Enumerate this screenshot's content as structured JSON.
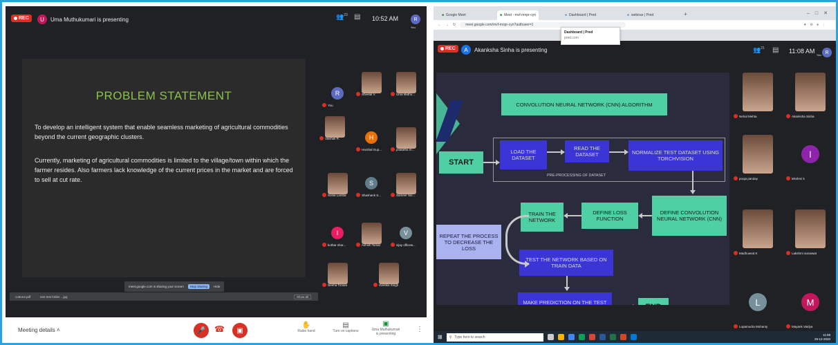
{
  "left": {
    "rec": "REC",
    "presenter_initial": "U",
    "presenter": "Uma Muthukumari is presenting",
    "time": "10:52 AM",
    "you_label": "You",
    "people_count": "23",
    "slide": {
      "title": "PROBLEM STATEMENT",
      "p1": "To develop an intelligent system that enable seamless marketing of agricultural commodities beyond the current geographic clusters.",
      "p2": "Currently, marketing of agricultural commodities is limited to the village/town within which the farmer resides. Also farmers lack knowledge of the current prices in the market and are forced to sell at cut rate."
    },
    "sharebar": {
      "text": "meet.google.com is sharing your screen",
      "stop": "Stop sharing",
      "hide": "Hide"
    },
    "downloads": [
      "cotton4.pdf",
      "test test folder ...jpg"
    ],
    "show_all": "Show all",
    "participants": [
      {
        "name": "You",
        "initial": "R",
        "color": "#5c6bc0",
        "photo": false
      },
      {
        "name": "Sheetal V.",
        "photo": true
      },
      {
        "name": "Uma Muthu...",
        "photo": true
      },
      {
        "name": "Vaishali R.",
        "photo": true
      },
      {
        "name": "Harshal Gup...",
        "initial": "H",
        "color": "#e8710a",
        "photo": false
      },
      {
        "name": "prakatha m...",
        "photo": true
      },
      {
        "name": "Sonia Lamba",
        "photo": true
      },
      {
        "name": "Shashank S...",
        "initial": "S",
        "color": "#607d8b",
        "photo": false
      },
      {
        "name": "Sameer Sin...",
        "photo": true
      },
      {
        "name": "kothar shar...",
        "initial": "I",
        "color": "#e91e63",
        "photo": false
      },
      {
        "name": "Ashish Tomar",
        "photo": true
      },
      {
        "name": "vijay officew...",
        "initial": "V",
        "color": "#78909c",
        "photo": false
      },
      {
        "name": "Neeha Tirnani",
        "photo": true
      },
      {
        "name": "Geetika Singh",
        "photo": true
      }
    ],
    "meeting_details": "Meeting details",
    "raise_hand": "Raise hand",
    "captions": "Turn on captions",
    "presenting": "Uma Muthukumari is presenting"
  },
  "right": {
    "tabs": [
      "Google Meet",
      "Meet - mvf-mnpr-cyn",
      "Dashboard | Pred",
      "webinar | Pred"
    ],
    "url": "meet.google.com/mvf-mnpr-cyn?authuser=1",
    "tooltip_title": "Dashboard | Pred",
    "tooltip_sub": "pred.com",
    "rec": "REC",
    "presenter_initial": "A",
    "presenter": "Akanksha Sinha is presenting",
    "time": "11:08 AM",
    "people_count": "21",
    "you_label": "You",
    "diagram": {
      "title": "CONVOLUTION NEURAL NETWORK (CNN) ALGORITHM",
      "start": "START",
      "load": "LOAD THE DATASET",
      "read": "READ THE DATASET",
      "normalize": "NORMALIZE TEST DATASET USING TORCHVISION",
      "preproc": "PRE-PROCESSING OF DATASET",
      "define_cnn": "DEFINE CONVOLUTION NEURAL NETWORK (CNN)",
      "define_loss": "DEFINE LOSS FUNCTION",
      "train": "TRAIN THE NETWORK",
      "repeat": "REPEAT THE PROCESS TO DECREASE THE LOSS",
      "test": "TEST THE NETWORK BASED ON TRAIN DATA",
      "predict": "MAKE PREDICTION ON THE TEST DATA",
      "end": "END"
    },
    "participants": [
      {
        "name": "Nehal Mehta",
        "photo": true
      },
      {
        "name": "Akanksha Sinha",
        "photo": true
      },
      {
        "name": "pooja panday",
        "photo": true
      },
      {
        "name": "lekshmi k",
        "initial": "l",
        "color": "#8e24aa",
        "photo": false
      },
      {
        "name": "Madhuwrat K",
        "photo": true
      },
      {
        "name": "Lakshmi saraswat",
        "photo": true
      },
      {
        "name": "Lopamudra Mohanty",
        "initial": "L",
        "color": "#78909c",
        "photo": false
      },
      {
        "name": "Mayank Vaidya",
        "initial": "M",
        "color": "#c2185b",
        "photo": false
      }
    ],
    "taskbar_search": "Type here to search",
    "taskbar_time": "11:08",
    "taskbar_date": "29-12-2020"
  }
}
